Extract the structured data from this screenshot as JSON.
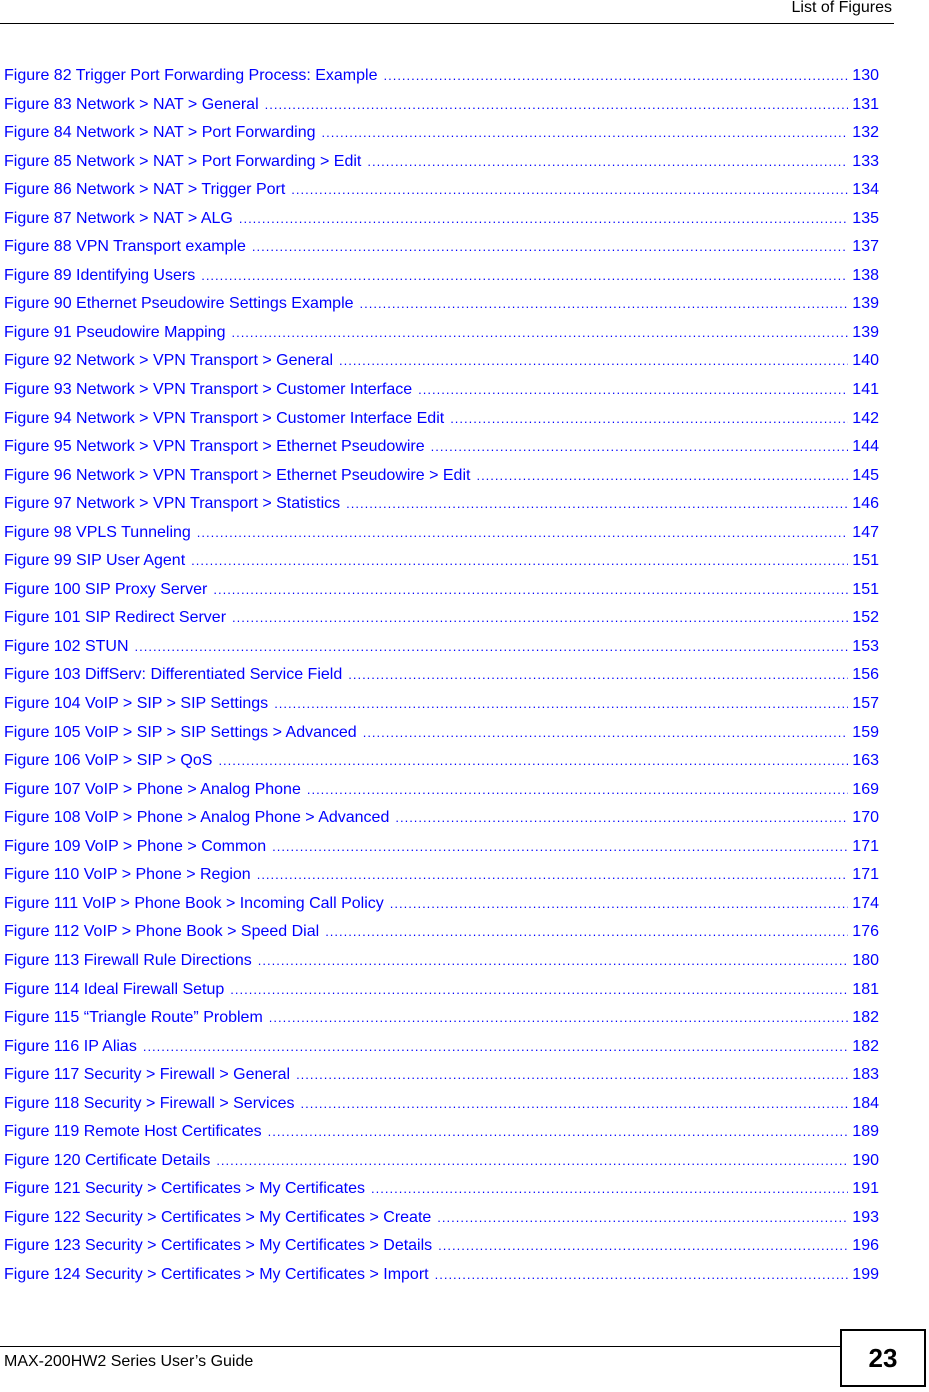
{
  "header": {
    "title": "List of Figures"
  },
  "toc": {
    "entries": [
      {
        "label": "Figure 82 Trigger Port Forwarding Process: Example",
        "page": "130"
      },
      {
        "label": "Figure 83 Network > NAT > General",
        "page": "131"
      },
      {
        "label": "Figure 84 Network > NAT > Port Forwarding",
        "page": "132"
      },
      {
        "label": "Figure 85 Network > NAT > Port Forwarding > Edit",
        "page": "133"
      },
      {
        "label": "Figure 86 Network > NAT > Trigger Port",
        "page": "134"
      },
      {
        "label": "Figure 87 Network > NAT > ALG",
        "page": "135"
      },
      {
        "label": "Figure 88 VPN Transport example",
        "page": "137"
      },
      {
        "label": "Figure 89 Identifying Users",
        "page": "138"
      },
      {
        "label": "Figure 90 Ethernet Pseudowire Settings Example",
        "page": "139"
      },
      {
        "label": "Figure 91 Pseudowire Mapping",
        "page": "139"
      },
      {
        "label": "Figure 92 Network > VPN Transport > General",
        "page": "140"
      },
      {
        "label": "Figure 93 Network > VPN Transport > Customer Interface",
        "page": "141"
      },
      {
        "label": "Figure 94 Network > VPN Transport > Customer Interface Edit",
        "page": "142"
      },
      {
        "label": "Figure 95 Network > VPN Transport > Ethernet Pseudowire",
        "page": "144"
      },
      {
        "label": "Figure 96 Network > VPN Transport > Ethernet Pseudowire > Edit",
        "page": "145"
      },
      {
        "label": "Figure 97 Network > VPN Transport > Statistics",
        "page": "146"
      },
      {
        "label": "Figure 98 VPLS Tunneling",
        "page": "147"
      },
      {
        "label": "Figure 99 SIP User Agent",
        "page": "151"
      },
      {
        "label": "Figure 100 SIP Proxy Server",
        "page": "151"
      },
      {
        "label": "Figure 101 SIP Redirect Server",
        "page": "152"
      },
      {
        "label": "Figure 102 STUN",
        "page": "153"
      },
      {
        "label": "Figure 103 DiffServ: Differentiated Service Field",
        "page": "156"
      },
      {
        "label": "Figure 104 VoIP > SIP > SIP Settings",
        "page": "157"
      },
      {
        "label": "Figure 105 VoIP > SIP > SIP Settings > Advanced",
        "page": "159"
      },
      {
        "label": "Figure 106 VoIP > SIP > QoS",
        "page": "163"
      },
      {
        "label": "Figure 107 VoIP > Phone > Analog Phone",
        "page": "169"
      },
      {
        "label": "Figure 108 VoIP > Phone > Analog Phone > Advanced",
        "page": "170"
      },
      {
        "label": "Figure 109 VoIP > Phone > Common",
        "page": "171"
      },
      {
        "label": "Figure 110 VoIP > Phone > Region",
        "page": "171"
      },
      {
        "label": "Figure 111 VoIP > Phone Book > Incoming Call Policy",
        "page": "174"
      },
      {
        "label": "Figure 112 VoIP > Phone Book > Speed Dial",
        "page": "176"
      },
      {
        "label": "Figure 113 Firewall Rule Directions",
        "page": "180"
      },
      {
        "label": "Figure 114 Ideal Firewall Setup",
        "page": "181"
      },
      {
        "label": "Figure 115 “Triangle Route” Problem",
        "page": "182"
      },
      {
        "label": "Figure 116 IP Alias",
        "page": "182"
      },
      {
        "label": "Figure 117 Security > Firewall > General",
        "page": "183"
      },
      {
        "label": "Figure 118 Security > Firewall > Services",
        "page": "184"
      },
      {
        "label": "Figure 119 Remote Host Certificates",
        "page": "189"
      },
      {
        "label": "Figure 120 Certificate Details",
        "page": "190"
      },
      {
        "label": "Figure 121 Security > Certificates > My Certificates",
        "page": "191"
      },
      {
        "label": "Figure 122 Security > Certificates > My Certificates > Create",
        "page": "193"
      },
      {
        "label": "Figure 123 Security > Certificates > My Certificates > Details",
        "page": "196"
      },
      {
        "label": "Figure 124 Security > Certificates > My Certificates > Import",
        "page": "199"
      }
    ]
  },
  "footer": {
    "guide_title": "MAX-200HW2 Series User’s Guide",
    "page_number": "23"
  },
  "colors": {
    "link": "#0000ff",
    "text": "#000000",
    "background": "#ffffff"
  }
}
